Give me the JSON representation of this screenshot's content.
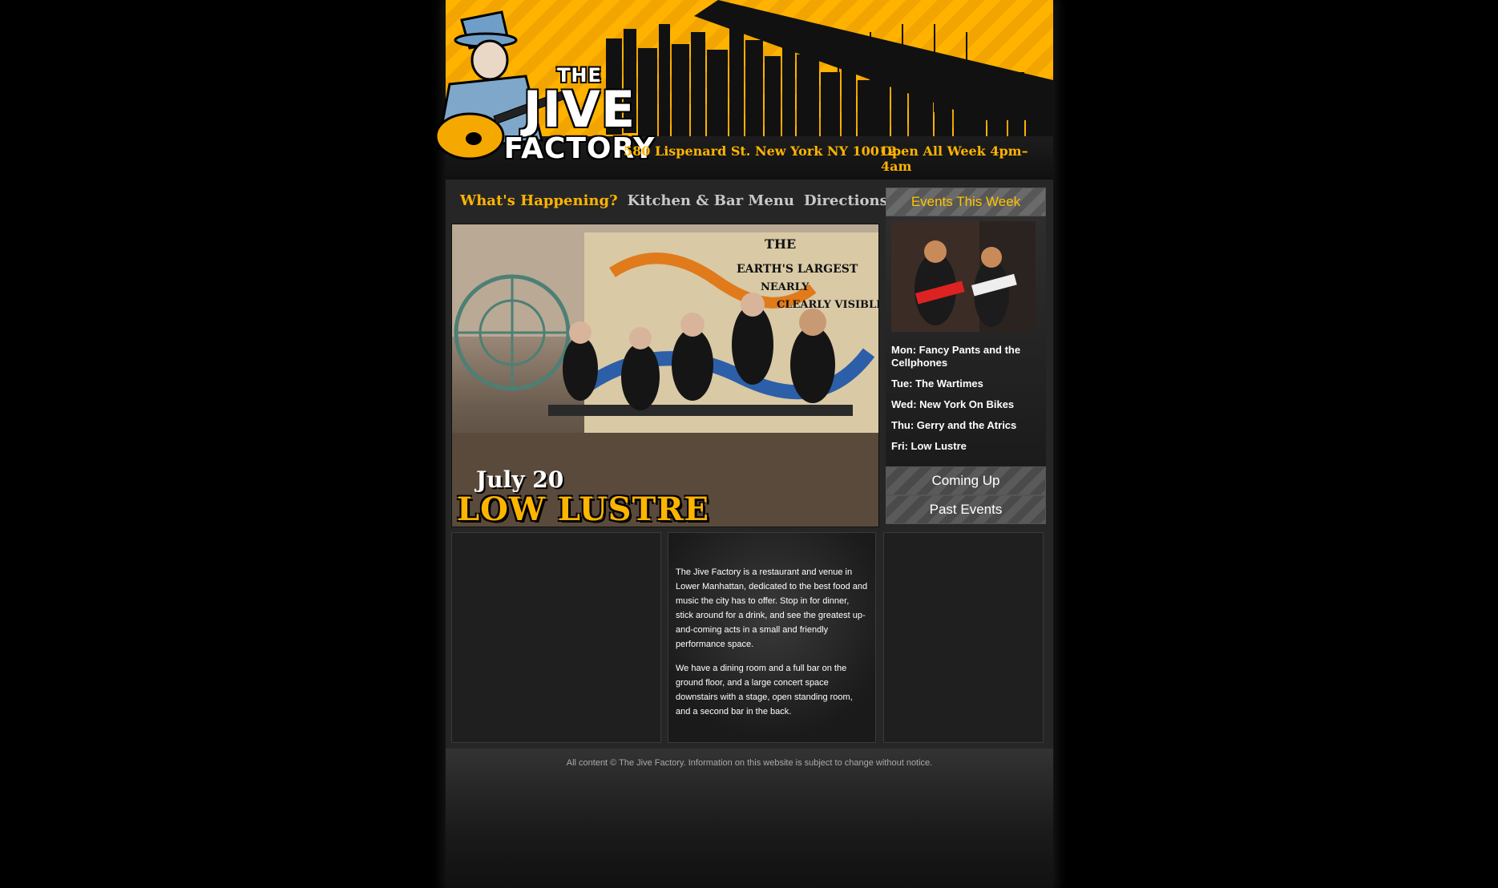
{
  "header": {
    "logo": {
      "the": "THE",
      "jive": "JIVE",
      "factory": "FACTORY"
    },
    "address": "580 Lispenard St. New York NY 10012",
    "hours": "Open All Week 4pm–4am"
  },
  "nav": {
    "items": [
      {
        "label": "What's Happening?",
        "active": true
      },
      {
        "label": "Kitchen & Bar Menu",
        "active": false
      },
      {
        "label": "Directions",
        "active": false
      }
    ]
  },
  "hero": {
    "date": "July 20",
    "band": "LOW LUSTRE",
    "mural_text": "EARTH'S LARGEST NEARLY CLEARLY VISIBLE"
  },
  "sidebar": {
    "events_title": "Events This Week",
    "events": [
      "Mon: Fancy Pants and the Cellphones",
      "Tue: The Wartimes",
      "Wed: New York On Bikes",
      "Thu: Gerry and the Atrics",
      "Fri: Low Lustre"
    ],
    "coming_up": "Coming Up",
    "past_events": "Past Events"
  },
  "about": {
    "p1": "The Jive Factory is a restaurant and venue in Lower Manhattan, dedicated to the best food and music the city has to offer. Stop in for dinner, stick around for a drink, and see the greatest up-and-coming acts in a small and friendly performance space.",
    "p2": "We have a dining room and a full bar on the ground floor, and a large concert space downstairs with a stage, open standing room, and a second bar in the back."
  },
  "footer": {
    "copyright": "All content © The Jive Factory. Information on this website is subject to change without notice."
  },
  "colors": {
    "accent": "#ffb400",
    "background": "#000000",
    "panel": "#262626"
  }
}
